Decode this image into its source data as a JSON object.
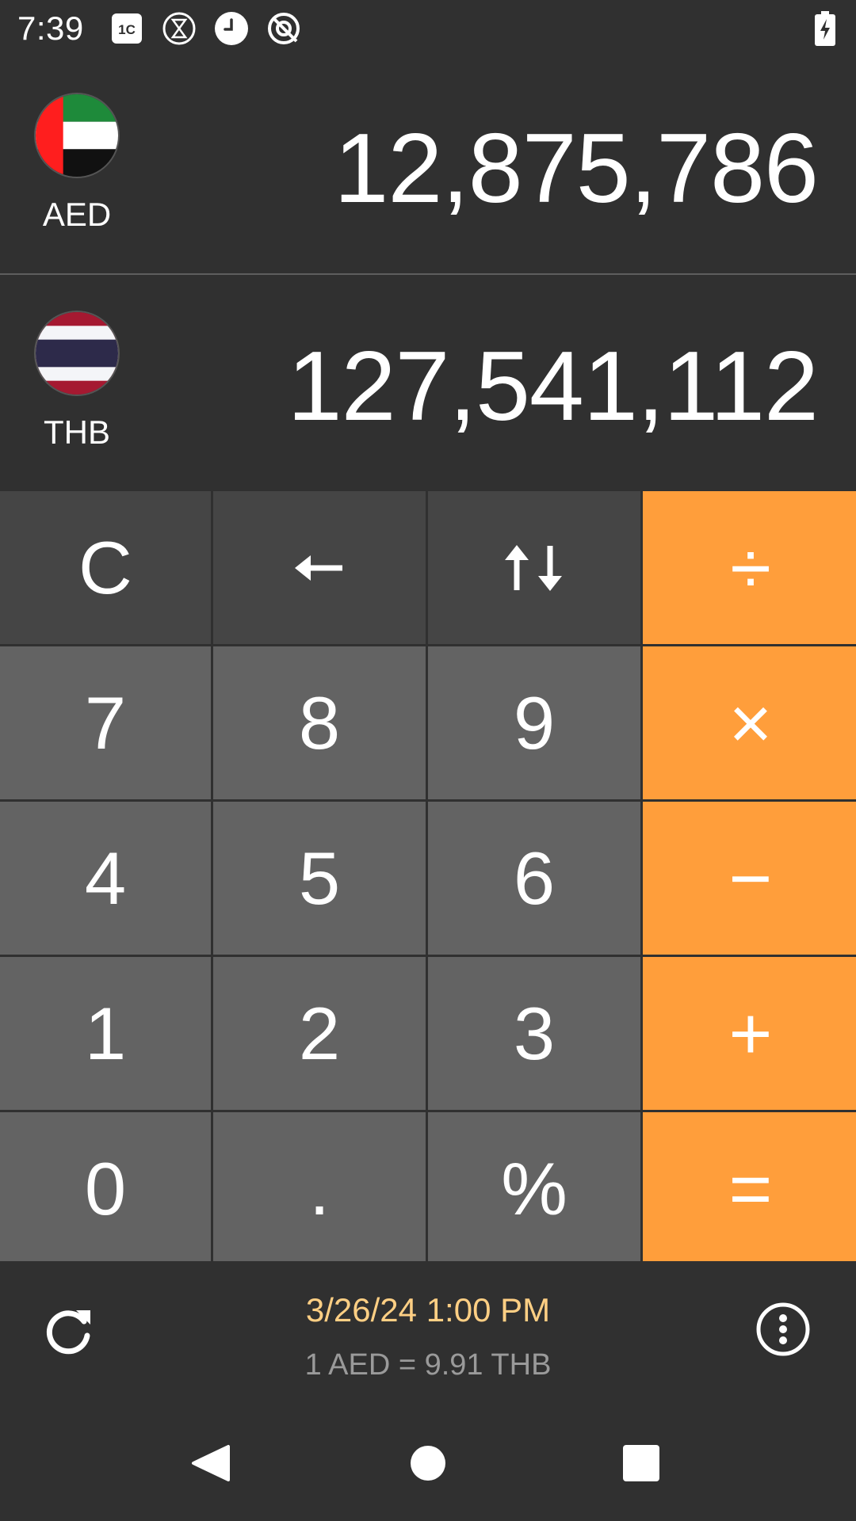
{
  "status_bar": {
    "time": "7:39",
    "icons": [
      "sim-card-icon",
      "hourglass-icon",
      "clock-icon",
      "no-data-icon"
    ],
    "battery": "battery-charging-icon"
  },
  "from_currency": {
    "code": "AED",
    "amount": "12,875,786",
    "flag": "uae-flag"
  },
  "to_currency": {
    "code": "THB",
    "amount": "127,541,112",
    "flag": "thailand-flag"
  },
  "keypad": {
    "clear": "C",
    "backspace_icon": "backspace-arrow-icon",
    "swap_icon": "swap-arrows-icon",
    "divide": "÷",
    "seven": "7",
    "eight": "8",
    "nine": "9",
    "multiply": "×",
    "four": "4",
    "five": "5",
    "six": "6",
    "minus": "−",
    "one": "1",
    "two": "2",
    "three": "3",
    "plus": "+",
    "zero": "0",
    "dot": ".",
    "percent": "%",
    "equals": "="
  },
  "footer": {
    "updated": "3/26/24 1:00 PM",
    "rate": "1 AED = 9.91 THB",
    "refresh_icon": "refresh-icon",
    "more_icon": "more-options-icon"
  },
  "nav": [
    "back-icon",
    "home-icon",
    "recents-icon"
  ],
  "colors": {
    "background": "#303030",
    "function_key": "#454545",
    "number_key": "#636363",
    "operator_key": "#ff9e3b",
    "date_text": "#ffcf84",
    "rate_text": "#9a9a9a"
  }
}
